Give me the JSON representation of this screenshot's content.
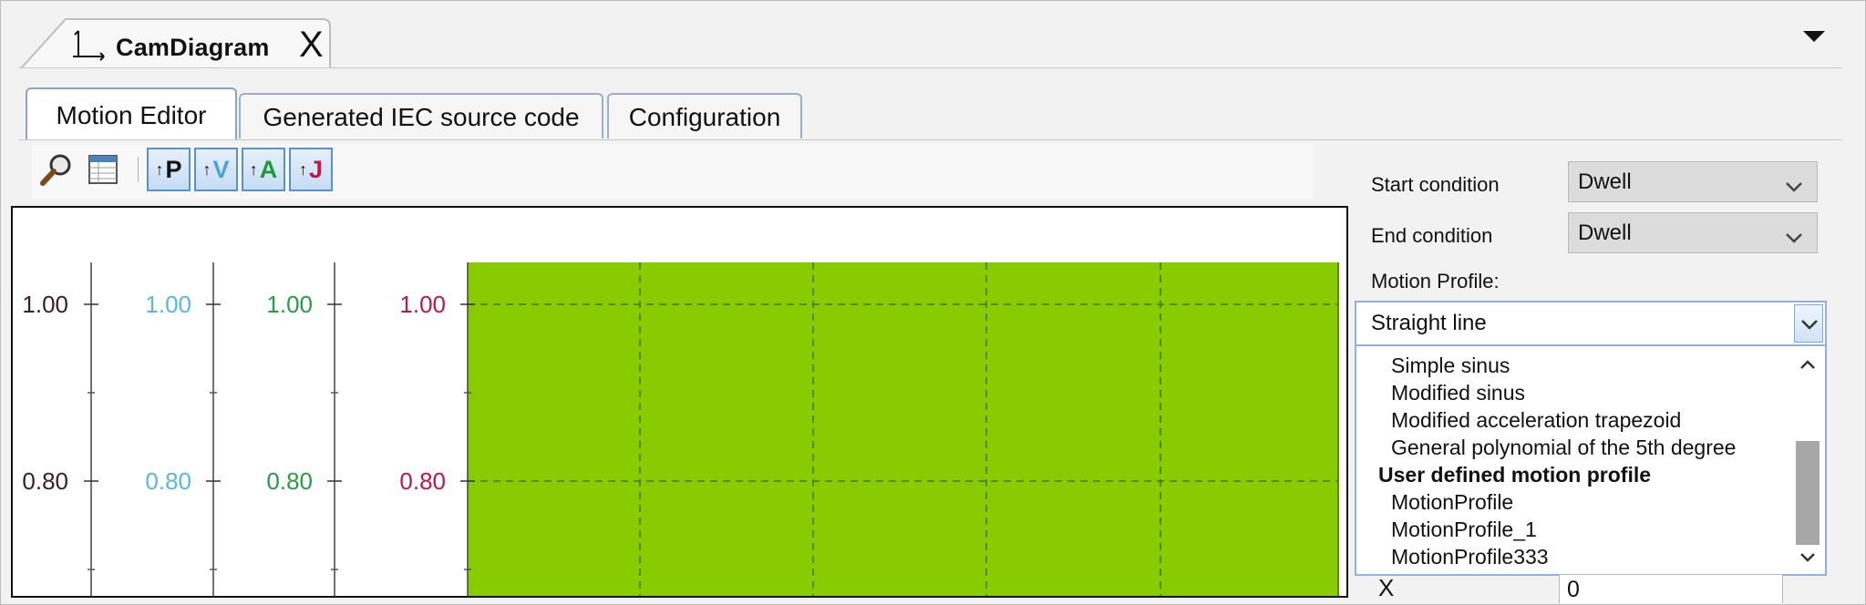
{
  "document_tab": {
    "title": "CamDiagram",
    "close_label": "X",
    "icon": "axis-icon"
  },
  "menu": {
    "icon": "dropdown-arrow-icon"
  },
  "tabs": [
    {
      "label": "Motion Editor",
      "active": true
    },
    {
      "label": "Generated IEC source code",
      "active": false
    },
    {
      "label": "Configuration",
      "active": false
    }
  ],
  "toolbar": {
    "icons": [
      "zoom-icon",
      "table-icon"
    ],
    "buttons": [
      {
        "name": "position",
        "label": "P",
        "color": "#111111"
      },
      {
        "name": "velocity",
        "label": "V",
        "color": "#4aa3d8"
      },
      {
        "name": "acceleration",
        "label": "A",
        "color": "#1f9a3a"
      },
      {
        "name": "jerk",
        "label": "J",
        "color": "#c0164a"
      }
    ]
  },
  "chart_data": {
    "type": "area",
    "axes": [
      {
        "name": "position",
        "color": "#3a1f24",
        "ticks": [
          "1.00",
          "0.80"
        ]
      },
      {
        "name": "velocity",
        "color": "#5ab6e0",
        "ticks": [
          "1.00",
          "0.80"
        ]
      },
      {
        "name": "acceleration",
        "color": "#2a9a45",
        "ticks": [
          "1.00",
          "0.80"
        ]
      },
      {
        "name": "jerk",
        "color": "#c0164a",
        "ticks": [
          "1.00",
          "0.80"
        ]
      }
    ],
    "fill_color": "#88cc00",
    "grid": true
  },
  "settings": {
    "start_condition": {
      "label": "Start condition",
      "value": "Dwell"
    },
    "end_condition": {
      "label": "End condition",
      "value": "Dwell"
    },
    "motion_profile": {
      "label": "Motion Profile:",
      "value": "Straight line",
      "options": [
        {
          "label": "Simple sinus",
          "type": "item"
        },
        {
          "label": "Modified sinus",
          "type": "item"
        },
        {
          "label": "Modified acceleration trapezoid",
          "type": "item"
        },
        {
          "label": "General polynomial of the 5th degree",
          "type": "item"
        },
        {
          "label": "User defined motion profile",
          "type": "header"
        },
        {
          "label": "MotionProfile",
          "type": "item"
        },
        {
          "label": "MotionProfile_1",
          "type": "item"
        },
        {
          "label": "MotionProfile333",
          "type": "item"
        }
      ]
    },
    "x_field": {
      "label": "X",
      "value": "0"
    }
  },
  "colors": {
    "tab_border": "#9ab0c4",
    "combo_border": "#8fb3dc",
    "accent": "#5a8fd0"
  }
}
